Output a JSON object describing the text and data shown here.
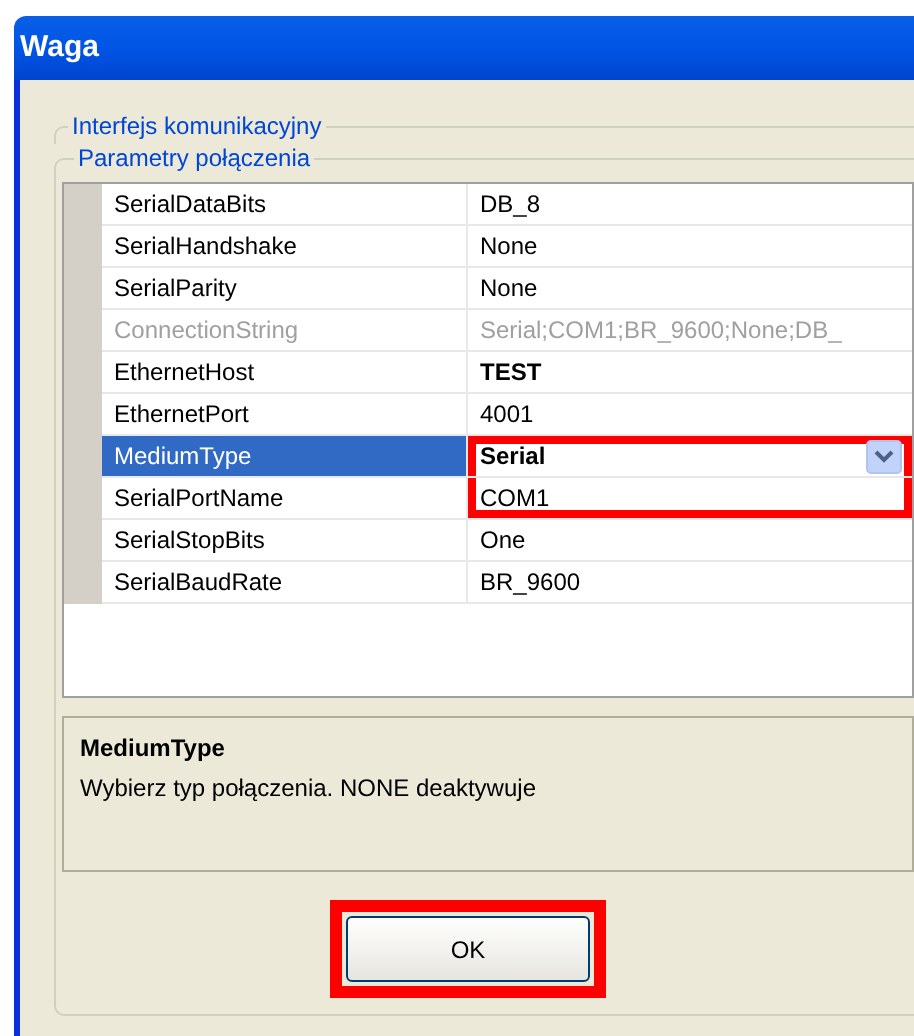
{
  "window": {
    "title": "Waga"
  },
  "groups": [
    {
      "label": "Interfejs komunikacyjny"
    },
    {
      "label": "Parametry połączenia"
    }
  ],
  "properties": [
    {
      "name": "SerialDataBits",
      "value": "DB_8",
      "kind": "text",
      "selected": false,
      "disabled": false,
      "modified": false,
      "highlighted": false
    },
    {
      "name": "SerialHandshake",
      "value": "None",
      "kind": "text",
      "selected": false,
      "disabled": false,
      "modified": false,
      "highlighted": false
    },
    {
      "name": "SerialParity",
      "value": "None",
      "kind": "text",
      "selected": false,
      "disabled": false,
      "modified": false,
      "highlighted": false
    },
    {
      "name": "ConnectionString",
      "value": "Serial;COM1;BR_9600;None;DB_",
      "kind": "text",
      "selected": false,
      "disabled": true,
      "modified": false,
      "highlighted": false
    },
    {
      "name": "EthernetHost",
      "value": "TEST",
      "kind": "text",
      "selected": false,
      "disabled": false,
      "modified": true,
      "highlighted": false
    },
    {
      "name": "EthernetPort",
      "value": "4001",
      "kind": "text",
      "selected": false,
      "disabled": false,
      "modified": false,
      "highlighted": false
    },
    {
      "name": "MediumType",
      "value": "Serial",
      "kind": "dropdown",
      "selected": true,
      "disabled": false,
      "modified": true,
      "highlighted": true
    },
    {
      "name": "SerialPortName",
      "value": "COM1",
      "kind": "text",
      "selected": false,
      "disabled": false,
      "modified": false,
      "highlighted": true
    },
    {
      "name": "SerialStopBits",
      "value": "One",
      "kind": "text",
      "selected": false,
      "disabled": false,
      "modified": false,
      "highlighted": false
    },
    {
      "name": "SerialBaudRate",
      "value": "BR_9600",
      "kind": "text",
      "selected": false,
      "disabled": false,
      "modified": false,
      "highlighted": false
    }
  ],
  "description": {
    "title": "MediumType",
    "text": "Wybierz typ połączenia. NONE deaktywuje"
  },
  "ok_button": {
    "label": "OK",
    "highlighted": true
  }
}
